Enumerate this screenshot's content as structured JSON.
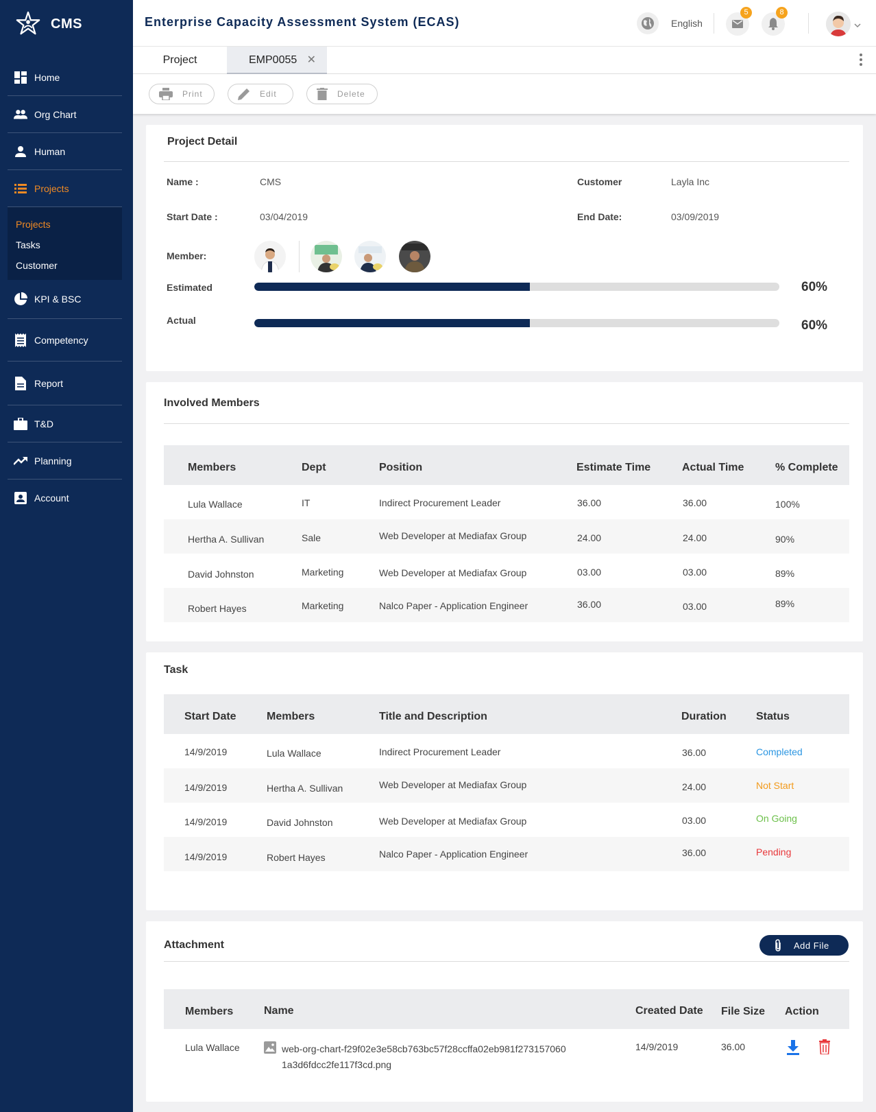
{
  "brand": {
    "name": "CMS"
  },
  "sidebar": {
    "items": [
      {
        "label": "Home",
        "icon": "dashboard-icon"
      },
      {
        "label": "Org Chart",
        "icon": "people-icon"
      },
      {
        "label": "Human",
        "icon": "person-icon"
      },
      {
        "label": "Projects",
        "icon": "list-icon",
        "active": true
      },
      {
        "label": "KPI & BSC",
        "icon": "pie-chart-icon"
      },
      {
        "label": "Competency",
        "icon": "receipt-icon"
      },
      {
        "label": "Report",
        "icon": "document-icon"
      },
      {
        "label": "T&D",
        "icon": "briefcase-icon"
      },
      {
        "label": "Planning",
        "icon": "trending-up-icon"
      },
      {
        "label": "Account",
        "icon": "account-box-icon"
      }
    ],
    "subitems": [
      "Projects",
      "Tasks",
      "Customer"
    ]
  },
  "header": {
    "title": "Enterprise Capacity Assessment System (ECAS)",
    "language": "English",
    "mail_count": "5",
    "notification_count": "8"
  },
  "tabs": {
    "project": "Project",
    "record": "EMP0055"
  },
  "toolbar": {
    "print": "Print",
    "edit": "Edit",
    "delete": "Delete"
  },
  "project_detail": {
    "title": "Project Detail",
    "name_label": "Name :",
    "name_value": "CMS",
    "customer_label": "Customer",
    "customer_value": "Layla Inc",
    "start_label": "Start Date :",
    "start_value": "03/04/2019",
    "end_label": "End Date:",
    "end_value": "03/09/2019",
    "member_label": "Member:",
    "estimated_label": "Estimated",
    "estimated_pct": "60%",
    "estimated_fraction": 0.525,
    "actual_label": "Actual",
    "actual_pct": "60%",
    "actual_fraction": 0.525
  },
  "involved": {
    "title": "Involved Members",
    "headers": [
      "Members",
      "Dept",
      "Position",
      "Estimate Time",
      "Actual Time",
      "% Complete"
    ],
    "rows": [
      [
        "Lula Wallace",
        "IT",
        "Indirect Procurement Leader",
        "36.00",
        "36.00",
        "100%"
      ],
      [
        "Hertha A. Sullivan",
        "Sale",
        "Web Developer at Mediafax Group",
        "24.00",
        "24.00",
        "90%"
      ],
      [
        "David Johnston",
        "Marketing",
        "Web Developer at Mediafax Group",
        "03.00",
        "03.00",
        "89%"
      ],
      [
        "Robert Hayes",
        "Marketing",
        "Nalco Paper - Application Engineer",
        "36.00",
        "03.00",
        "89%"
      ]
    ]
  },
  "task": {
    "title": "Task",
    "headers": [
      "Start Date",
      "Members",
      "Title and Description",
      "Duration",
      "Status"
    ],
    "rows": [
      [
        "14/9/2019",
        "Lula Wallace",
        "Indirect Procurement Leader",
        "36.00",
        "Completed"
      ],
      [
        "14/9/2019",
        "Hertha A. Sullivan",
        "Web Developer at Mediafax Group",
        "24.00",
        "Not Start"
      ],
      [
        "14/9/2019",
        "David Johnston",
        "Web Developer at Mediafax Group",
        "03.00",
        "On Going"
      ],
      [
        "14/9/2019",
        "Robert Hayes",
        "Nalco Paper - Application Engineer",
        "36.00",
        "Pending"
      ]
    ],
    "status_colors": {
      "Completed": "#2b96e2",
      "Not Start": "#f29a1b",
      "On Going": "#6cc04a",
      "Pending": "#e8373a"
    }
  },
  "attachment": {
    "title": "Attachment",
    "add_file": "Add File",
    "headers": [
      "Members",
      "Name",
      "Created Date",
      "File Size",
      "Action"
    ],
    "rows": [
      {
        "member": "Lula Wallace",
        "name_line1": "web-org-chart-f29f02e3e58cb763bc57f28ccffa02eb981f273157060",
        "name_line2": "1a3d6fdcc2fe117f3cd.png",
        "created": "14/9/2019",
        "size": "36.00"
      }
    ]
  },
  "colors": {
    "navy": "#0e2a56",
    "accent": "#f08a24",
    "badge": "#f6a31d",
    "delete": "#e8373a",
    "download": "#1a73e8"
  }
}
